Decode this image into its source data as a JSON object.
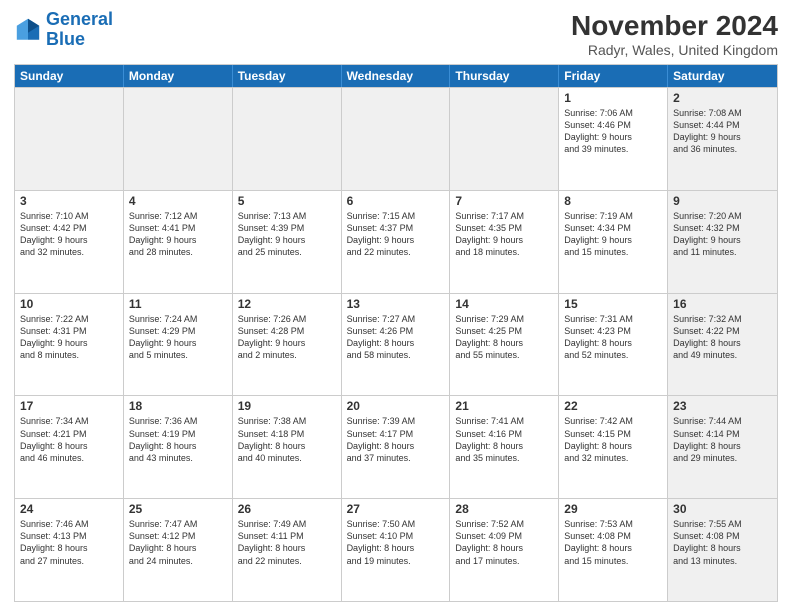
{
  "logo": {
    "line1": "General",
    "line2": "Blue"
  },
  "title": "November 2024",
  "location": "Radyr, Wales, United Kingdom",
  "days_of_week": [
    "Sunday",
    "Monday",
    "Tuesday",
    "Wednesday",
    "Thursday",
    "Friday",
    "Saturday"
  ],
  "weeks": [
    [
      {
        "day": "",
        "info": "",
        "shaded": true
      },
      {
        "day": "",
        "info": "",
        "shaded": true
      },
      {
        "day": "",
        "info": "",
        "shaded": true
      },
      {
        "day": "",
        "info": "",
        "shaded": true
      },
      {
        "day": "",
        "info": "",
        "shaded": true
      },
      {
        "day": "1",
        "info": "Sunrise: 7:06 AM\nSunset: 4:46 PM\nDaylight: 9 hours\nand 39 minutes.",
        "shaded": false
      },
      {
        "day": "2",
        "info": "Sunrise: 7:08 AM\nSunset: 4:44 PM\nDaylight: 9 hours\nand 36 minutes.",
        "shaded": true
      }
    ],
    [
      {
        "day": "3",
        "info": "Sunrise: 7:10 AM\nSunset: 4:42 PM\nDaylight: 9 hours\nand 32 minutes.",
        "shaded": false
      },
      {
        "day": "4",
        "info": "Sunrise: 7:12 AM\nSunset: 4:41 PM\nDaylight: 9 hours\nand 28 minutes.",
        "shaded": false
      },
      {
        "day": "5",
        "info": "Sunrise: 7:13 AM\nSunset: 4:39 PM\nDaylight: 9 hours\nand 25 minutes.",
        "shaded": false
      },
      {
        "day": "6",
        "info": "Sunrise: 7:15 AM\nSunset: 4:37 PM\nDaylight: 9 hours\nand 22 minutes.",
        "shaded": false
      },
      {
        "day": "7",
        "info": "Sunrise: 7:17 AM\nSunset: 4:35 PM\nDaylight: 9 hours\nand 18 minutes.",
        "shaded": false
      },
      {
        "day": "8",
        "info": "Sunrise: 7:19 AM\nSunset: 4:34 PM\nDaylight: 9 hours\nand 15 minutes.",
        "shaded": false
      },
      {
        "day": "9",
        "info": "Sunrise: 7:20 AM\nSunset: 4:32 PM\nDaylight: 9 hours\nand 11 minutes.",
        "shaded": true
      }
    ],
    [
      {
        "day": "10",
        "info": "Sunrise: 7:22 AM\nSunset: 4:31 PM\nDaylight: 9 hours\nand 8 minutes.",
        "shaded": false
      },
      {
        "day": "11",
        "info": "Sunrise: 7:24 AM\nSunset: 4:29 PM\nDaylight: 9 hours\nand 5 minutes.",
        "shaded": false
      },
      {
        "day": "12",
        "info": "Sunrise: 7:26 AM\nSunset: 4:28 PM\nDaylight: 9 hours\nand 2 minutes.",
        "shaded": false
      },
      {
        "day": "13",
        "info": "Sunrise: 7:27 AM\nSunset: 4:26 PM\nDaylight: 8 hours\nand 58 minutes.",
        "shaded": false
      },
      {
        "day": "14",
        "info": "Sunrise: 7:29 AM\nSunset: 4:25 PM\nDaylight: 8 hours\nand 55 minutes.",
        "shaded": false
      },
      {
        "day": "15",
        "info": "Sunrise: 7:31 AM\nSunset: 4:23 PM\nDaylight: 8 hours\nand 52 minutes.",
        "shaded": false
      },
      {
        "day": "16",
        "info": "Sunrise: 7:32 AM\nSunset: 4:22 PM\nDaylight: 8 hours\nand 49 minutes.",
        "shaded": true
      }
    ],
    [
      {
        "day": "17",
        "info": "Sunrise: 7:34 AM\nSunset: 4:21 PM\nDaylight: 8 hours\nand 46 minutes.",
        "shaded": false
      },
      {
        "day": "18",
        "info": "Sunrise: 7:36 AM\nSunset: 4:19 PM\nDaylight: 8 hours\nand 43 minutes.",
        "shaded": false
      },
      {
        "day": "19",
        "info": "Sunrise: 7:38 AM\nSunset: 4:18 PM\nDaylight: 8 hours\nand 40 minutes.",
        "shaded": false
      },
      {
        "day": "20",
        "info": "Sunrise: 7:39 AM\nSunset: 4:17 PM\nDaylight: 8 hours\nand 37 minutes.",
        "shaded": false
      },
      {
        "day": "21",
        "info": "Sunrise: 7:41 AM\nSunset: 4:16 PM\nDaylight: 8 hours\nand 35 minutes.",
        "shaded": false
      },
      {
        "day": "22",
        "info": "Sunrise: 7:42 AM\nSunset: 4:15 PM\nDaylight: 8 hours\nand 32 minutes.",
        "shaded": false
      },
      {
        "day": "23",
        "info": "Sunrise: 7:44 AM\nSunset: 4:14 PM\nDaylight: 8 hours\nand 29 minutes.",
        "shaded": true
      }
    ],
    [
      {
        "day": "24",
        "info": "Sunrise: 7:46 AM\nSunset: 4:13 PM\nDaylight: 8 hours\nand 27 minutes.",
        "shaded": false
      },
      {
        "day": "25",
        "info": "Sunrise: 7:47 AM\nSunset: 4:12 PM\nDaylight: 8 hours\nand 24 minutes.",
        "shaded": false
      },
      {
        "day": "26",
        "info": "Sunrise: 7:49 AM\nSunset: 4:11 PM\nDaylight: 8 hours\nand 22 minutes.",
        "shaded": false
      },
      {
        "day": "27",
        "info": "Sunrise: 7:50 AM\nSunset: 4:10 PM\nDaylight: 8 hours\nand 19 minutes.",
        "shaded": false
      },
      {
        "day": "28",
        "info": "Sunrise: 7:52 AM\nSunset: 4:09 PM\nDaylight: 8 hours\nand 17 minutes.",
        "shaded": false
      },
      {
        "day": "29",
        "info": "Sunrise: 7:53 AM\nSunset: 4:08 PM\nDaylight: 8 hours\nand 15 minutes.",
        "shaded": false
      },
      {
        "day": "30",
        "info": "Sunrise: 7:55 AM\nSunset: 4:08 PM\nDaylight: 8 hours\nand 13 minutes.",
        "shaded": true
      }
    ]
  ]
}
